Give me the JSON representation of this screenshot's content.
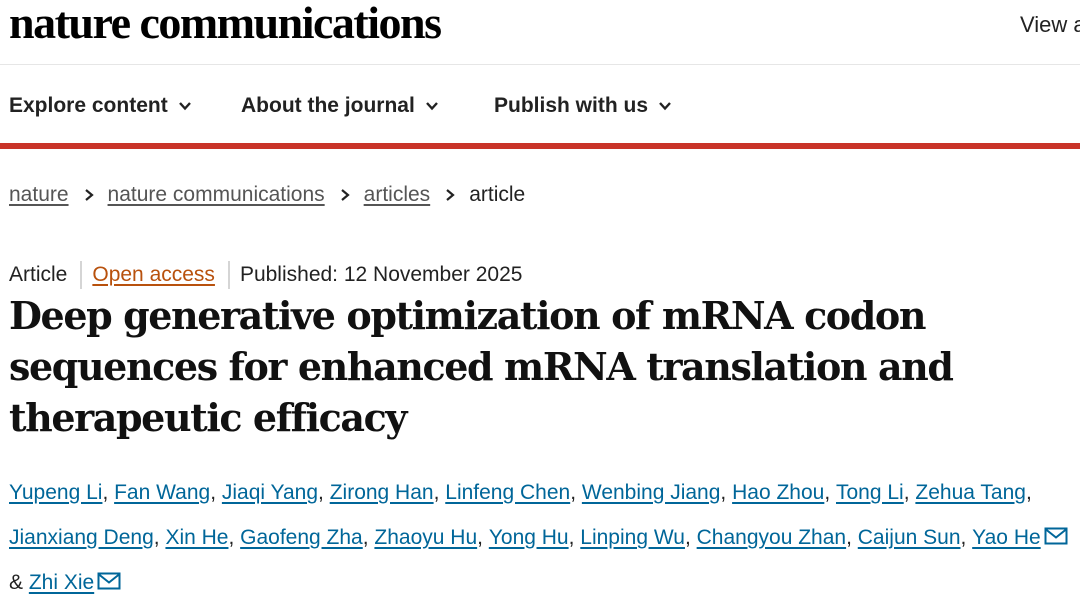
{
  "header": {
    "logo_text": "nature communications",
    "view_link": "View a"
  },
  "nav": {
    "items": [
      {
        "label": "Explore content",
        "icon": "chevron-down-icon"
      },
      {
        "label": "About the journal",
        "icon": "chevron-down-icon"
      },
      {
        "label": "Publish with us",
        "icon": "chevron-down-icon"
      }
    ]
  },
  "breadcrumb": {
    "items": [
      "nature",
      "nature communications",
      "articles"
    ],
    "current": "article",
    "separator_icon": "chevron-right-icon"
  },
  "article": {
    "type": "Article",
    "access": "Open access",
    "published": "Published: 12 November 2025",
    "title": "Deep generative optimization of mRNA codon sequences for enhanced mRNA translation and therapeutic efficacy",
    "authors": [
      {
        "name": "Yupeng Li",
        "sep": ", "
      },
      {
        "name": "Fan Wang",
        "sep": ", "
      },
      {
        "name": "Jiaqi Yang",
        "sep": ", "
      },
      {
        "name": "Zirong Han",
        "sep": ", "
      },
      {
        "name": "Linfeng Chen",
        "sep": ", "
      },
      {
        "name": "Wenbing Jiang",
        "sep": ", "
      },
      {
        "name": "Hao Zhou",
        "sep": ", "
      },
      {
        "name": "Tong Li",
        "sep": ", "
      },
      {
        "name": "Zehua Tang",
        "sep": ", "
      },
      {
        "name": "Jianxiang Deng",
        "sep": ", "
      },
      {
        "name": "Xin He",
        "sep": ", "
      },
      {
        "name": "Gaofeng Zha",
        "sep": ", "
      },
      {
        "name": "Zhaoyu Hu",
        "sep": ", "
      },
      {
        "name": "Yong Hu",
        "sep": ", "
      },
      {
        "name": "Linping Wu",
        "sep": ", "
      },
      {
        "name": "Changyou Zhan",
        "sep": ", "
      },
      {
        "name": "Caijun Sun",
        "sep": ", "
      },
      {
        "name": "Yao He",
        "sep": " & ",
        "email_icon": "mail-icon"
      },
      {
        "name": "Zhi Xie",
        "sep": "",
        "email_icon": "mail-icon"
      }
    ]
  },
  "colors": {
    "accent_bar": "#c93328",
    "author_link": "#006699",
    "open_access": "#b8510d"
  }
}
